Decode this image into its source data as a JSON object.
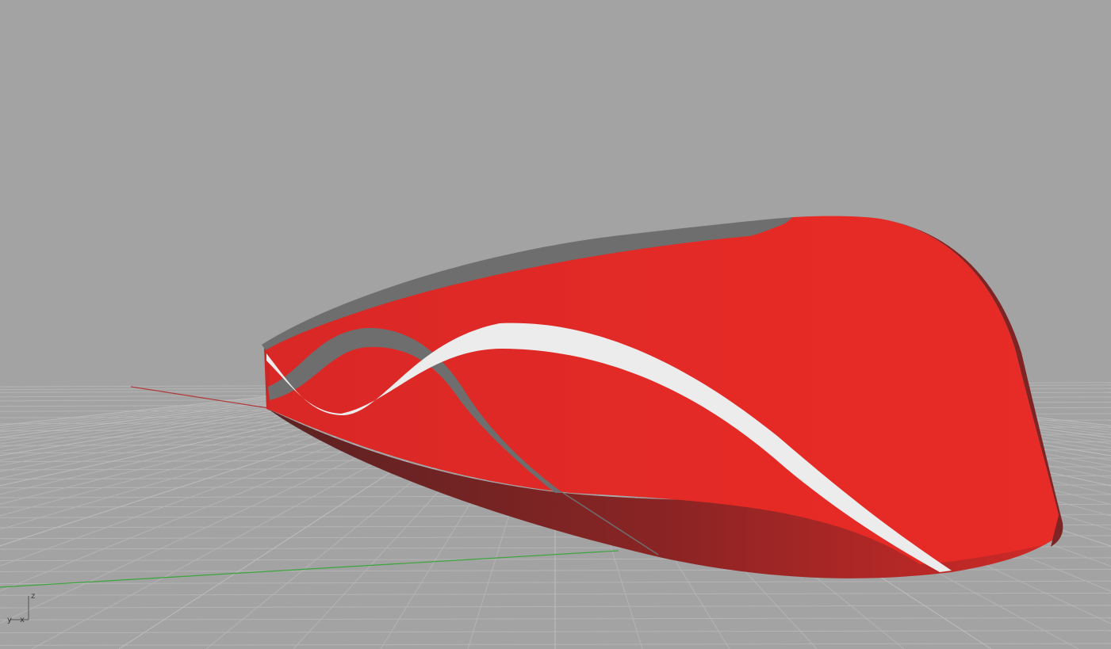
{
  "viewport": {
    "background_color": "#a3a3a3",
    "grid_color": "#b4b4b4",
    "grid_major_color": "#bdbdbd"
  },
  "world_axes": {
    "x_axis_color": "#b03a3a",
    "y_axis_color": "#3aa53a"
  },
  "model": {
    "body_color": "#e72b27",
    "shadow_color": "#7e2424",
    "edge_color": "#6e6e6e",
    "stripe_color": "#ececec"
  },
  "axis_gizmo": {
    "z_label": "z",
    "y_label": "y",
    "x_label": "x"
  }
}
